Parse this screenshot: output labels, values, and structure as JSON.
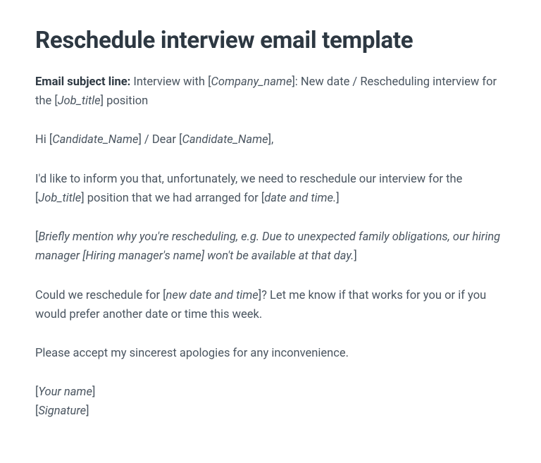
{
  "heading": "Reschedule interview email template",
  "subject": {
    "label": "Email subject line:",
    "before_company": " Interview with [",
    "company_placeholder": "Company_name",
    "after_company": "]: New date / Rescheduling interview for the [",
    "job_title_placeholder": "Job_title",
    "after_job": "] position"
  },
  "greeting": {
    "before1": "Hi [",
    "candidate1": "Candidate_Name",
    "mid": "] / Dear [",
    "candidate2": "Candidate_Name",
    "after": "],"
  },
  "para1": {
    "part1": "I'd like to inform you that, unfortunately, we need to reschedule our interview for the [",
    "job_title": "Job_title",
    "part2": "] position that we had arranged for [",
    "datetime": "date and time.",
    "part3": "]"
  },
  "para2": {
    "open": "[",
    "text": "Briefly mention why you're rescheduling, e.g. Due to unexpected family obligations, our hiring manager [Hiring manager's name] won't be available at that day.",
    "close": "]"
  },
  "para3": {
    "part1": "Could we reschedule for [",
    "new_datetime": "new date and time",
    "part2": "]? Let me know if that works for you or if you would prefer another date or time this week."
  },
  "para4": "Please accept my sincerest apologies for any inconvenience.",
  "signoff": {
    "open1": "[",
    "your_name": "Your name",
    "close1": "]",
    "open2": "[",
    "signature": "Signature",
    "close2": "]"
  }
}
